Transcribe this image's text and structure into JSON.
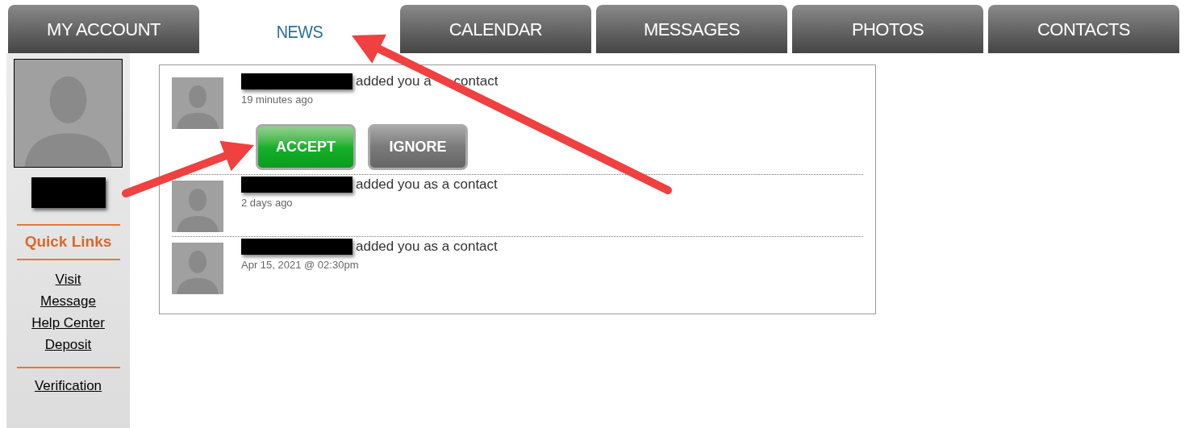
{
  "tabs": [
    {
      "label": "MY ACCOUNT",
      "selected": false
    },
    {
      "label": "NEWS",
      "selected": true
    },
    {
      "label": "CALENDAR",
      "selected": false
    },
    {
      "label": "MESSAGES",
      "selected": false
    },
    {
      "label": "PHOTOS",
      "selected": false
    },
    {
      "label": "CONTACTS",
      "selected": false
    }
  ],
  "sidebar": {
    "quick_links_title": "Quick Links",
    "links": [
      "Visit",
      "Message",
      "Help Center",
      "Deposit"
    ],
    "extra_links": [
      "Verification"
    ]
  },
  "feed": [
    {
      "text_parts": [
        "added you a",
        "contact"
      ],
      "time": "19 minutes ago",
      "actions": [
        {
          "label": "ACCEPT",
          "kind": "accept"
        },
        {
          "label": "IGNORE",
          "kind": "ignore"
        }
      ]
    },
    {
      "text_parts": [
        "added you as a contact"
      ],
      "time": "2 days ago"
    },
    {
      "text_parts": [
        "added you as a contact"
      ],
      "time": "Apr 15, 2021 @ 02:30pm"
    }
  ]
}
